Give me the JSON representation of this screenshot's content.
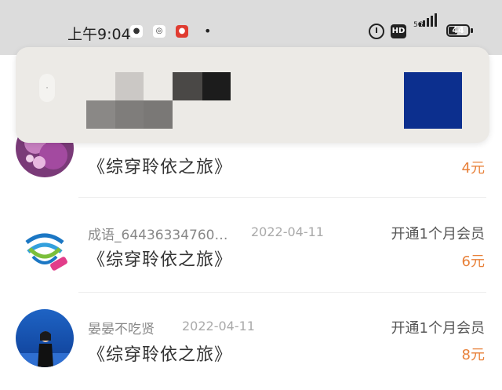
{
  "status_bar": {
    "time": "上午9:04",
    "network": "5G",
    "hd_label": "HD",
    "battery": "44",
    "battery_level": 0.44
  },
  "notification": {
    "app_icon": "app-icon"
  },
  "records": [
    {
      "username": "",
      "date": "",
      "action": "",
      "book": "《综穿聆依之旅》",
      "price": "4元",
      "avatar": "flower-avatar"
    },
    {
      "username": "成语_64436334760…",
      "date": "2022-04-11",
      "action": "开通1个月会员",
      "book": "《综穿聆依之旅》",
      "price": "6元",
      "avatar": "china-mobile-logo-avatar"
    },
    {
      "username": "晏晏不吃贤",
      "date": "2022-04-11",
      "action": "开通1个月会员",
      "book": "《综穿聆依之旅》",
      "price": "8元",
      "avatar": "person-avatar"
    }
  ]
}
